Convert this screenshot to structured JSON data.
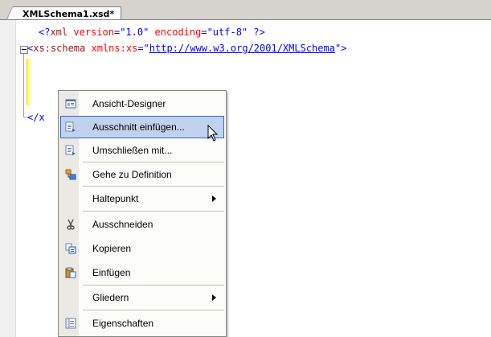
{
  "tab": {
    "title": "XMLSchema1.xsd*"
  },
  "code": {
    "line1": {
      "open": "<?",
      "kw": "xml",
      "a1": "version",
      "eq1": "=",
      "v1": "\"1.0\"",
      "a2": "encoding",
      "eq2": "=",
      "v2": "\"utf-8\"",
      "close": " ?>"
    },
    "line2": {
      "open": "<",
      "tag": "xs:schema",
      "attr": "xmlns:xs",
      "eq": "=",
      "q1": "\"",
      "url": "http://www.w3.org/2001/XMLSchema",
      "q2": "\"",
      "close": ">"
    },
    "line3": {
      "text": "</x"
    }
  },
  "menu": {
    "items": [
      {
        "label": "Ansicht-Designer",
        "icon": "view-designer-icon"
      },
      {
        "label": "Ausschnitt einfügen...",
        "icon": "insert-snippet-icon",
        "highlighted": true
      },
      {
        "label": "Umschließen mit...",
        "icon": "surround-with-icon"
      },
      {
        "label": "Gehe zu Definition",
        "icon": "go-to-definition-icon"
      },
      {
        "label": "Haltepunkt",
        "icon": "",
        "submenu": true
      },
      {
        "label": "Ausschneiden",
        "icon": "scissors-icon"
      },
      {
        "label": "Kopieren",
        "icon": "copy-icon"
      },
      {
        "label": "Einfügen",
        "icon": "paste-icon"
      },
      {
        "label": "Gliedern",
        "icon": "",
        "submenu": true
      },
      {
        "label": "Eigenschaften",
        "icon": "properties-icon"
      }
    ]
  },
  "colors": {
    "highlight": "#c1d2ee",
    "highlight_border": "#316ac5",
    "keyword": "#0000ff",
    "element": "#a31515",
    "attribute": "#ff0000"
  }
}
